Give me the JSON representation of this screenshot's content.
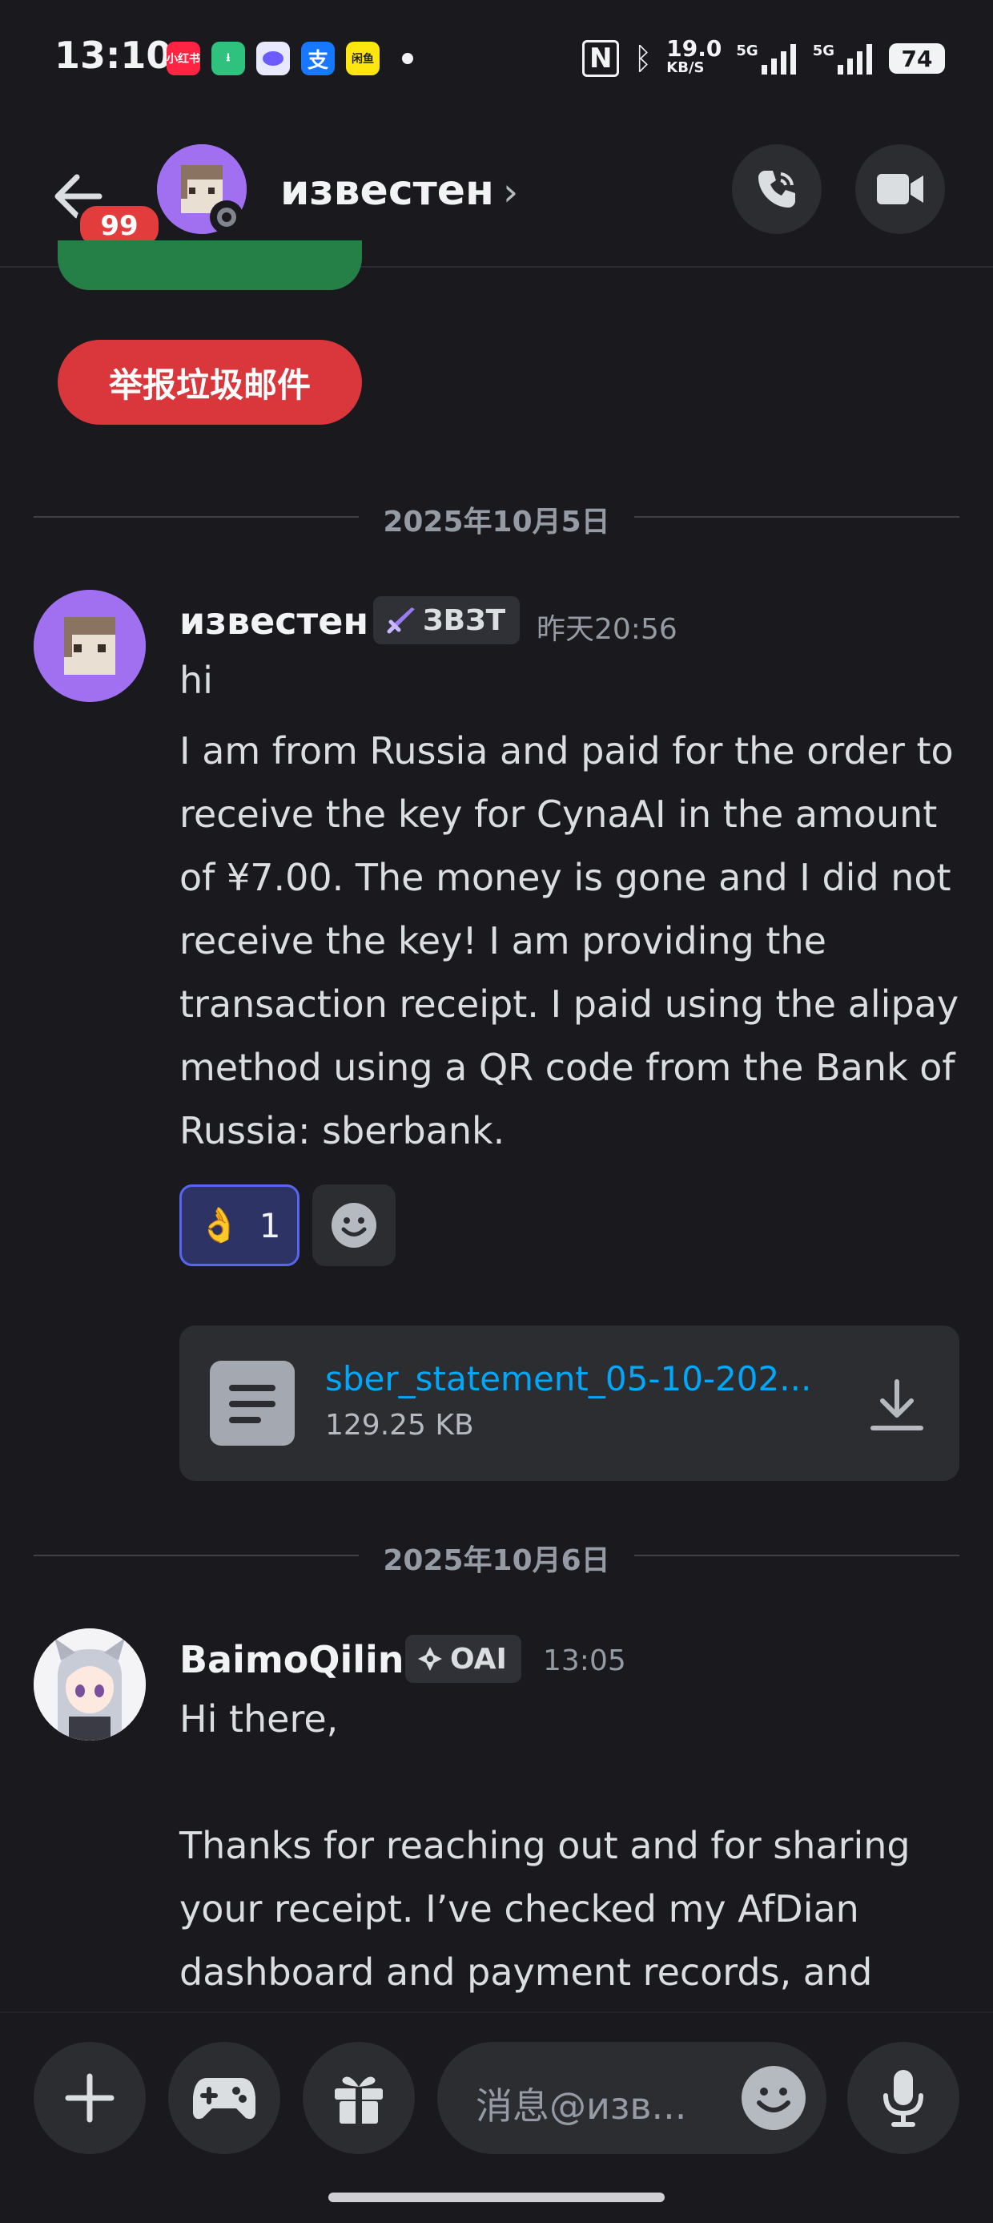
{
  "status_bar": {
    "time": "13:10",
    "apps": [
      {
        "name": "xiaohongshu-icon",
        "text": "小红书",
        "color": "#ff2442"
      },
      {
        "name": "download-app-icon",
        "text": "⭳",
        "color": "#2ec27e"
      },
      {
        "name": "chat-app-icon",
        "text": "",
        "color": "#e8e8ff"
      },
      {
        "name": "alipay-icon",
        "text": "支",
        "color": "#1677ff"
      },
      {
        "name": "xianyu-icon",
        "text": "闲鱼",
        "color": "#ffe60f"
      }
    ],
    "network_speed": "19.0",
    "network_unit": "KB/S",
    "battery": "74",
    "signal_label_1": "5G",
    "signal_label_2": "5G"
  },
  "header": {
    "badge_count": "99",
    "contact_name": "известен"
  },
  "spam_button_label": "举报垃圾邮件",
  "dividers": [
    "2025年10月5日",
    "2025年10月6日"
  ],
  "messages": [
    {
      "author": "известен",
      "tag": "ЗВЗТ",
      "timestamp": "昨天20:56",
      "text_line1": "hi",
      "text_body": "I am from Russia and paid for the order to receive the key for CynaAI in the amount of ¥7.00. The money is gone and I did not receive the key! I am providing the transaction receipt. I paid using the alipay method using a QR code from the Bank of Russia: sberbank.",
      "reaction_emoji": "👌",
      "reaction_count": "1",
      "attachment": {
        "name": "sber_statement_05-10-202...",
        "size": "129.25 KB"
      }
    },
    {
      "author": "BaimoQilin",
      "tag": "OAI",
      "timestamp": "13:05",
      "text_line1": "Hi there,",
      "text_body": "Thanks for reaching out and for sharing your receipt. I’ve checked my AfDian dashboard and payment records, and"
    }
  ],
  "input": {
    "placeholder": "消息@изв..."
  },
  "colors": {
    "background": "#1a1a1e",
    "blurple": "#5865f2",
    "danger": "#da373c",
    "link": "#00a8fc"
  }
}
